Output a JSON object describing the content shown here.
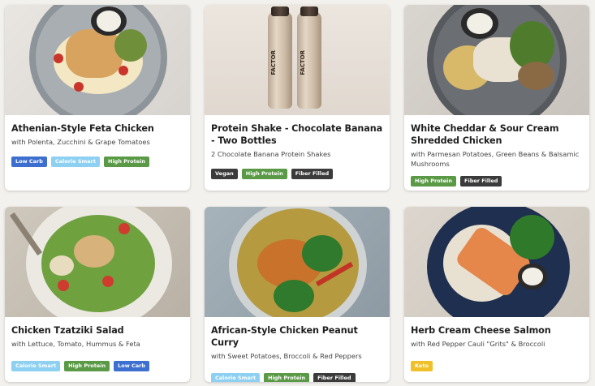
{
  "colors": {
    "low_carb": "#3c6fcf",
    "calorie_smart": "#8ed0f2",
    "high_protein": "#5a9a46",
    "vegan": "#3b3b3b",
    "fiber_filled": "#3b3b3b",
    "keto": "#f0c02b"
  },
  "brand_text": "FACTOR",
  "meals": [
    {
      "title": "Athenian-Style Feta Chicken",
      "subtitle": "with Polenta, Zucchini & Grape Tomatoes",
      "tags": [
        "Low Carb",
        "Calorie Smart",
        "High Protein"
      ]
    },
    {
      "title": "Protein Shake - Chocolate Banana - Two Bottles",
      "subtitle": "2 Chocolate Banana Protein Shakes",
      "tags": [
        "Vegan",
        "High Protein",
        "Fiber Filled"
      ]
    },
    {
      "title": "White Cheddar & Sour Cream Shredded Chicken",
      "subtitle": "with Parmesan Potatoes, Green Beans & Balsamic Mushrooms",
      "tags": [
        "High Protein",
        "Fiber Filled"
      ]
    },
    {
      "title": "Chicken Tzatziki Salad",
      "subtitle": "with Lettuce, Tomato, Hummus & Feta",
      "tags": [
        "Calorie Smart",
        "High Protein",
        "Low Carb"
      ]
    },
    {
      "title": "African-Style Chicken Peanut Curry",
      "subtitle": "with Sweet Potatoes, Broccoli & Red Peppers",
      "tags": [
        "Calorie Smart",
        "High Protein",
        "Fiber Filled"
      ]
    },
    {
      "title": "Herb Cream Cheese Salmon",
      "subtitle": "with Red Pepper Cauli \"Grits\" & Broccoli",
      "tags": [
        "Keto"
      ]
    }
  ]
}
